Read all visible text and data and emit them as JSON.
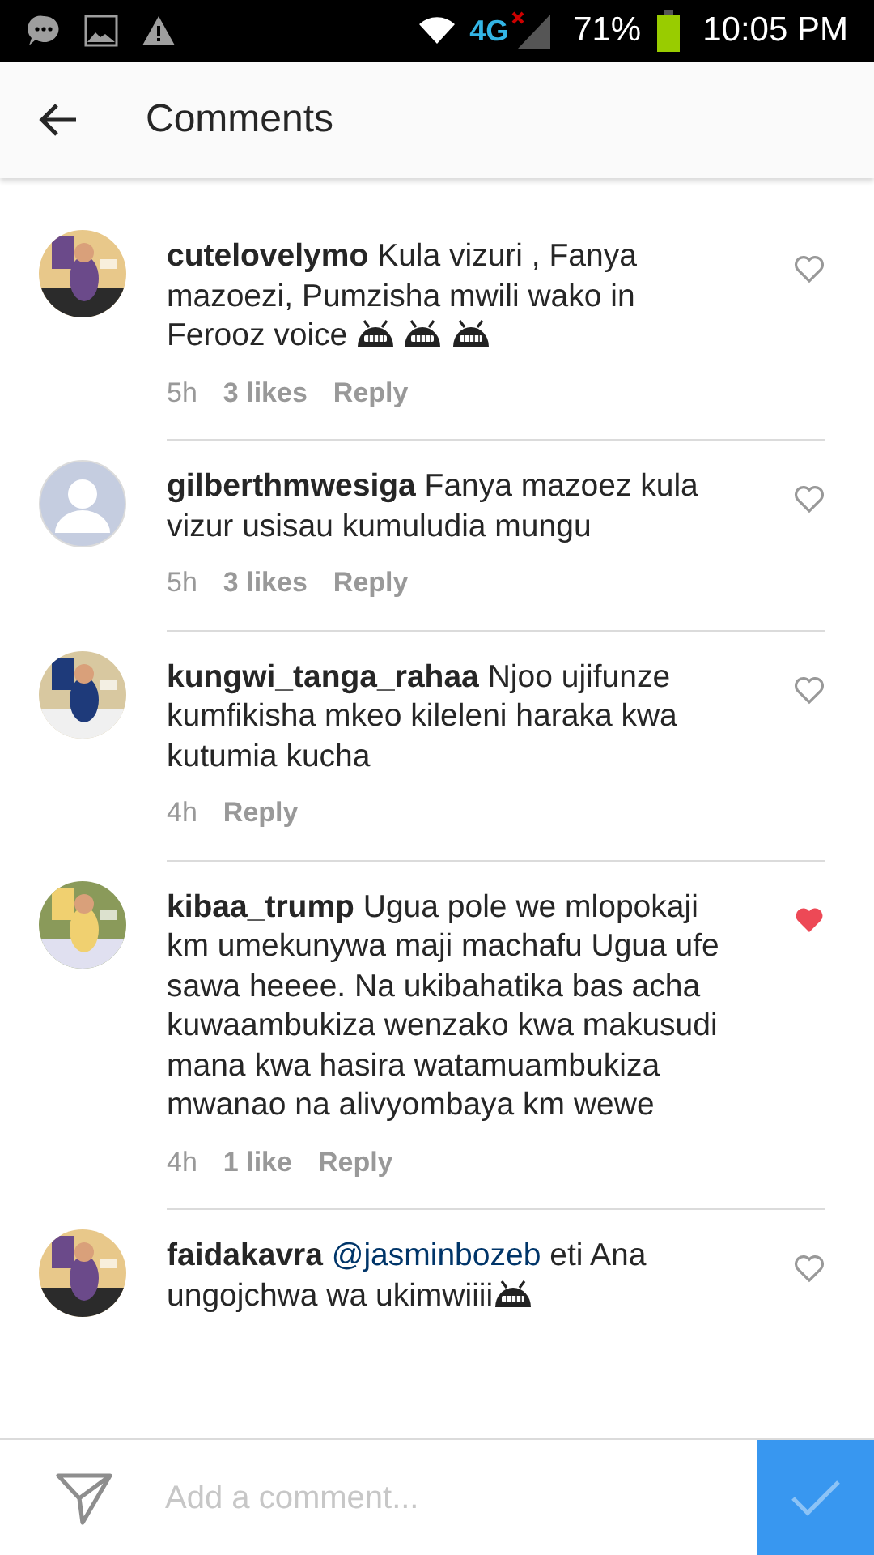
{
  "status_bar": {
    "battery": "71%",
    "time": "10:05 PM",
    "network": "4G"
  },
  "header": {
    "title": "Comments"
  },
  "comments": [
    {
      "username": "cutelovelymo",
      "text": "Kula vizuri , Fanya mazoezi, Pumzisha mwili wako in Ferooz voice",
      "emojis": [
        {
          "kind": "grin"
        },
        {
          "kind": "grin"
        },
        {
          "kind": "grin"
        }
      ],
      "time": "5h",
      "likes": "3 likes",
      "reply": "Reply",
      "liked": false
    },
    {
      "avatar": {
        "kind": "placeholder"
      },
      "username": "gilberthmwesiga",
      "text": "Fanya mazoez kula vizur usisau kumuludia mungu",
      "time": "5h",
      "likes": "3 likes",
      "reply": "Reply",
      "liked": false
    },
    {
      "username": "kungwi_tanga_rahaa",
      "text": "Njoo ujifunze kumfikisha mkeo kileleni haraka kwa kutumia kucha",
      "time": "4h",
      "reply": "Reply",
      "liked": false
    },
    {
      "username": "kibaa_trump",
      "text": "Ugua pole we mlopokaji km umekunywa maji machafu Ugua ufe sawa heeee. Na ukibahatika bas acha kuwaambukiza wenzako kwa makusudi mana kwa hasira watamuambukiza  mwanao na alivyombaya km wewe",
      "time": "4h",
      "likes": "1 like",
      "reply": "Reply",
      "liked": true
    },
    {
      "username": "faidakavra",
      "mention": "@jasminbozeb",
      "text": "eti Ana ungojchwa wa ukimwiiii",
      "emojis": [
        {
          "kind": "grin"
        }
      ],
      "liked": false
    }
  ],
  "composer": {
    "placeholder": "Add a comment..."
  }
}
